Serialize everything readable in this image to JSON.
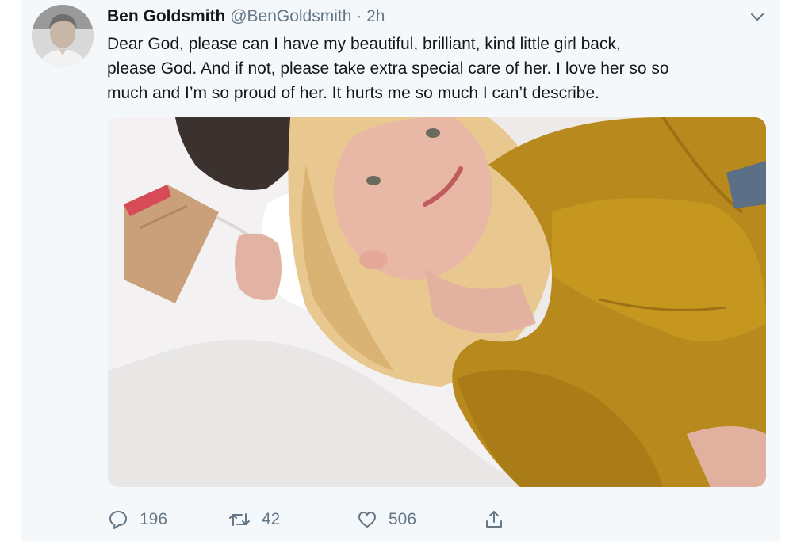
{
  "tweet": {
    "author": {
      "display_name": "Ben Goldsmith",
      "handle": "@BenGoldsmith",
      "separator": "·",
      "timestamp": "2h"
    },
    "text_lines": [
      "Dear God, please can I have my beautiful, brilliant, kind little girl back,",
      "please God. And if not, please take extra special care of her. I love her so so",
      "much and I’m so proud of her. It hurts me so much I can’t describe."
    ],
    "actions": {
      "replies": "196",
      "retweets": "42",
      "likes": "506"
    },
    "icons": {
      "menu": "chevron-down-icon",
      "reply": "reply-bubble-icon",
      "retweet": "retweet-arrows-icon",
      "like": "heart-icon",
      "share": "share-upload-icon"
    },
    "colors": {
      "background": "#f5f8fa",
      "text": "#14171a",
      "secondary_text": "#657786",
      "robe": "#b8891c"
    }
  }
}
